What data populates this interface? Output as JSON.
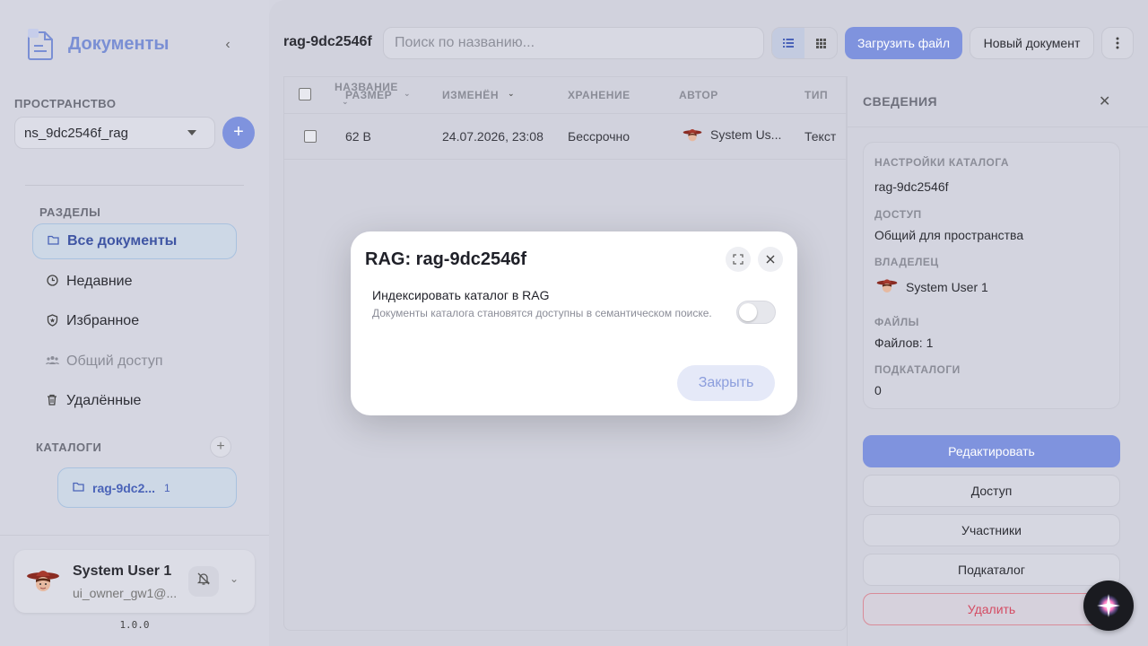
{
  "app": {
    "title": "Документы",
    "version": "1.0.0"
  },
  "sidebar": {
    "space_label": "ПРОСТРАНСТВО",
    "namespace_value": "ns_9dc2546f_rag",
    "sections_label": "РАЗДЕЛЫ",
    "items": [
      {
        "label": "Все документы",
        "icon": "folder-icon"
      },
      {
        "label": "Недавние",
        "icon": "clock-icon"
      },
      {
        "label": "Избранное",
        "icon": "shield-star-icon"
      },
      {
        "label": "Общий доступ",
        "icon": "users-icon"
      },
      {
        "label": "Удалённые",
        "icon": "trash-icon"
      }
    ],
    "catalogs_label": "КАТАЛОГИ",
    "catalogs": [
      {
        "label": "rag-9dc2...",
        "count": "1"
      }
    ]
  },
  "user": {
    "name": "System User 1",
    "email": "ui_owner_gw1@..."
  },
  "topbar": {
    "title": "rag-9dc2546f",
    "search_placeholder": "Поиск по названию...",
    "upload_label": "Загрузить файл",
    "new_doc_label": "Новый документ"
  },
  "table": {
    "columns": {
      "name": "НАЗВАНИЕ",
      "size": "РАЗМЕР",
      "modified": "ИЗМЕНЁН",
      "storage": "ХРАНЕНИЕ",
      "author": "АВТОР",
      "type": "ТИП"
    },
    "rows": [
      {
        "size": "62 B",
        "modified": "24.07.2026, 23:08",
        "storage": "Бессрочно",
        "author": "System Us...",
        "type": "Текст"
      }
    ]
  },
  "details": {
    "title": "СВЕДЕНИЯ",
    "settings_label": "НАСТРОЙКИ КАТАЛОГА",
    "settings_value": "rag-9dc2546f",
    "access_label": "ДОСТУП",
    "access_value": "Общий для пространства",
    "owner_label": "ВЛАДЕЛЕЦ",
    "owner_value": "System User 1",
    "files_label": "ФАЙЛЫ",
    "files_value": "Файлов: 1",
    "subcatalogs_label": "ПОДКАТАЛОГИ",
    "subcatalogs_value": "0",
    "buttons": {
      "edit": "Редактировать",
      "access": "Доступ",
      "members": "Участники",
      "subcatalog": "Подкаталог",
      "delete": "Удалить"
    }
  },
  "modal": {
    "title": "RAG: rag-9dc2546f",
    "toggle_title": "Индексировать каталог в RAG",
    "toggle_desc": "Документы каталога становятся доступны в семантическом поиске.",
    "toggle_on": false,
    "close_label": "Закрыть"
  },
  "colors": {
    "accent": "#7f93de",
    "danger": "#d44b62",
    "overlay_bg": "#d4d5e0",
    "logo": "#7a8fd4"
  }
}
